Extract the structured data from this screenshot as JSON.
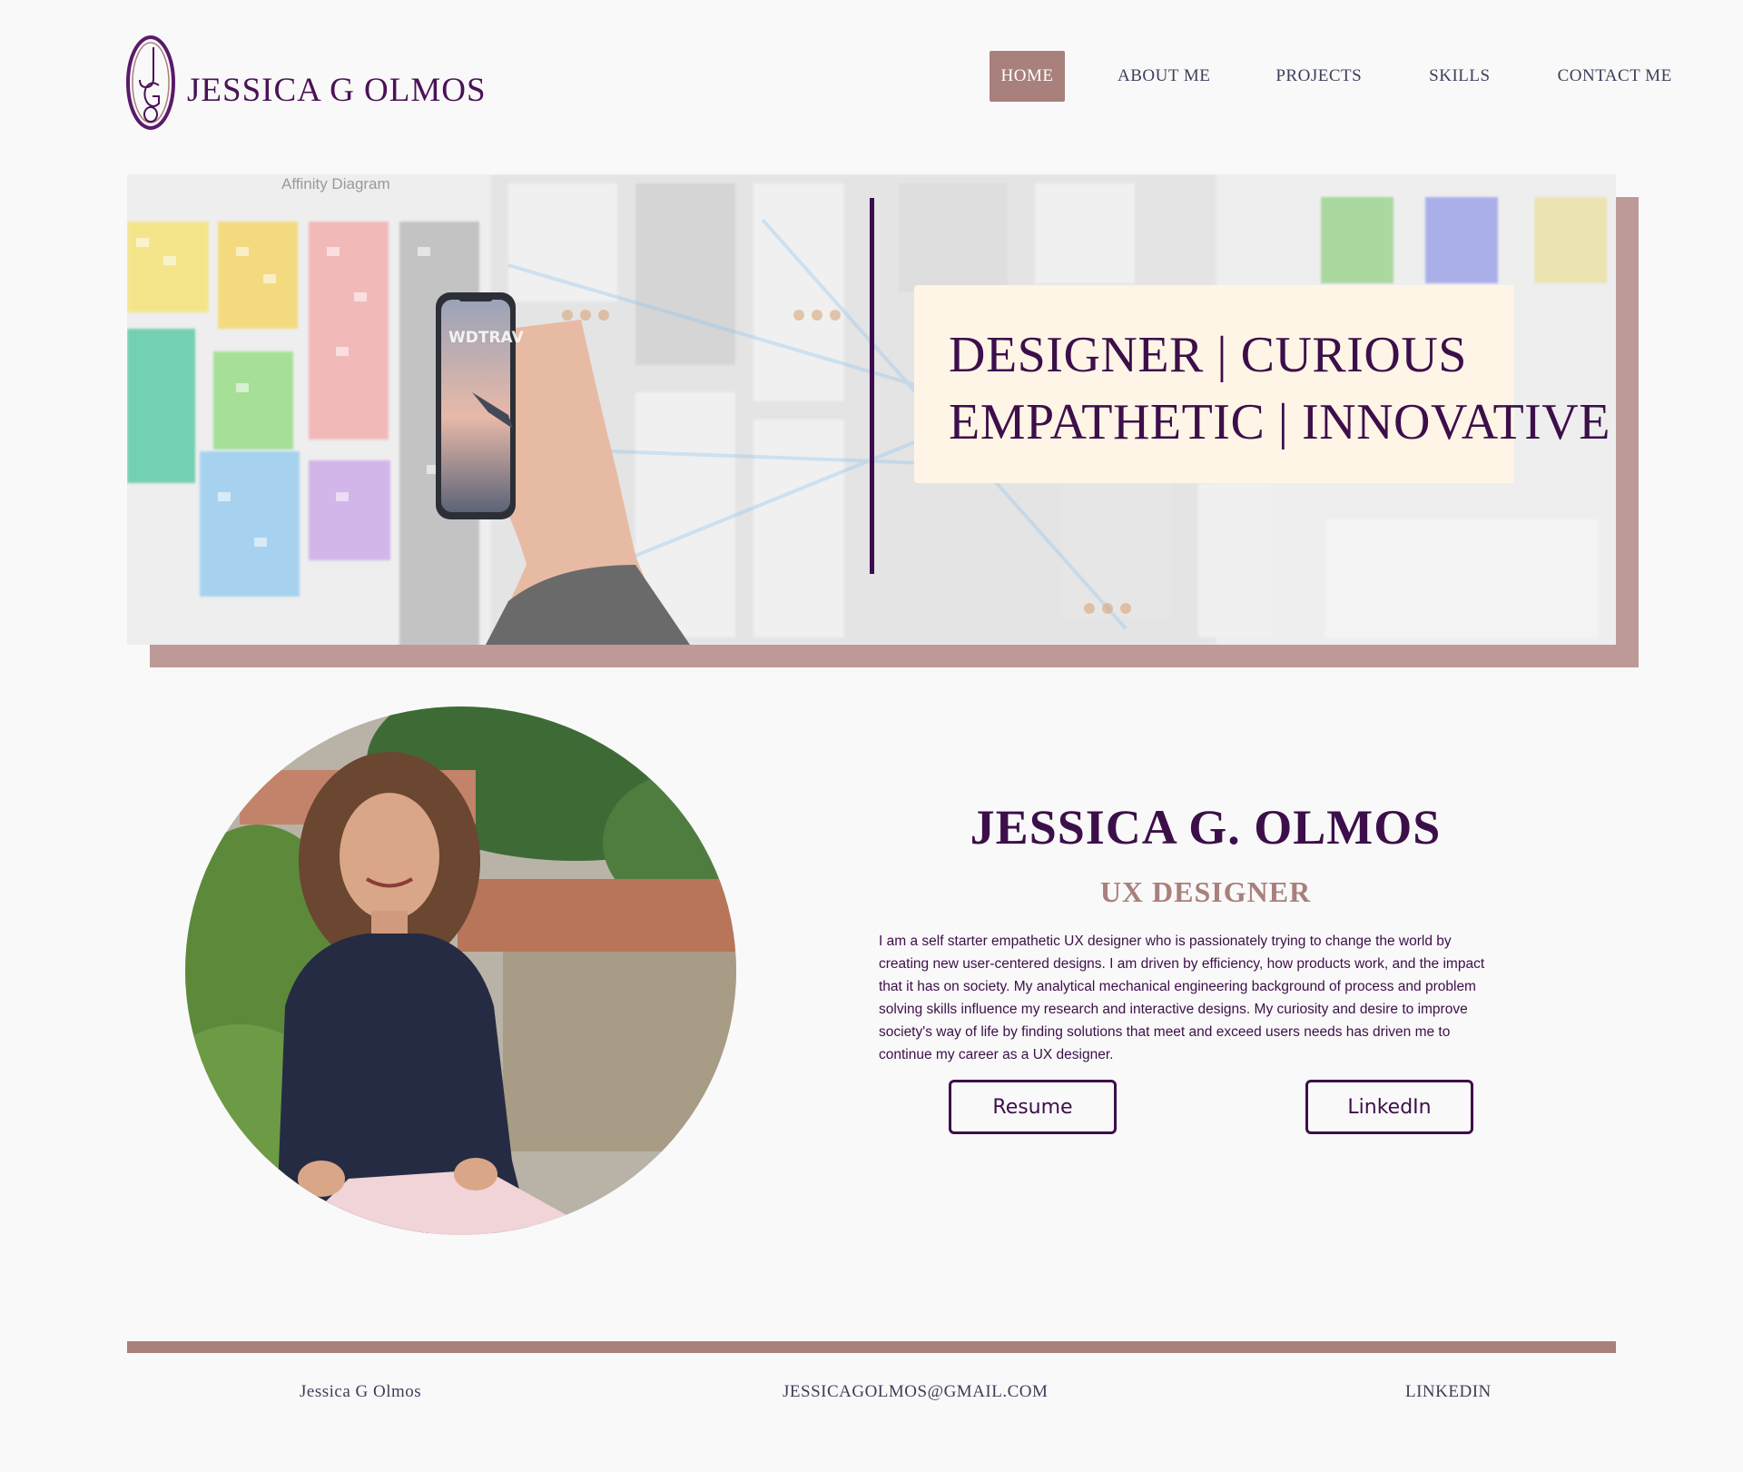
{
  "brand": {
    "logo_monogram": "JGO",
    "name": "JESSICA G OLMOS",
    "colors": {
      "primary": "#3d0f4a",
      "accent": "#a8807c",
      "banner": "#fff5e7",
      "background": "#faf9f9"
    }
  },
  "nav": {
    "items": [
      {
        "label": "HOME",
        "active": true
      },
      {
        "label": "ABOUT ME",
        "active": false
      },
      {
        "label": "PROJECTS",
        "active": false
      },
      {
        "label": "SKILLS",
        "active": false
      },
      {
        "label": "CONTACT ME",
        "active": false
      }
    ]
  },
  "hero": {
    "image_caption": "Affinity Diagram",
    "phone_label": "WDTRAV",
    "tagline": [
      "DESIGNER | CURIOUS",
      "EMPATHETIC | INNOVATIVE"
    ]
  },
  "profile": {
    "name": "JESSICA G. OLMOS",
    "role": "UX DESIGNER",
    "bio": "I am a self starter empathetic UX designer who is passionately trying to change the world by creating new user-centered designs.  I am driven by efficiency, how products work, and the impact that it has on society.    My analytical mechanical engineering background of process and problem solving skills influence my research and interactive designs. My curiosity and desire to improve society's way of life by finding solutions that meet and exceed users needs has driven me to continue my career as a UX designer.",
    "buttons": {
      "resume": "Resume",
      "linkedin": "LinkedIn"
    }
  },
  "footer": {
    "name": "Jessica G Olmos",
    "email": "JESSICAGOLMOS@GMAIL.COM",
    "linkedin": "LINKEDIN"
  }
}
